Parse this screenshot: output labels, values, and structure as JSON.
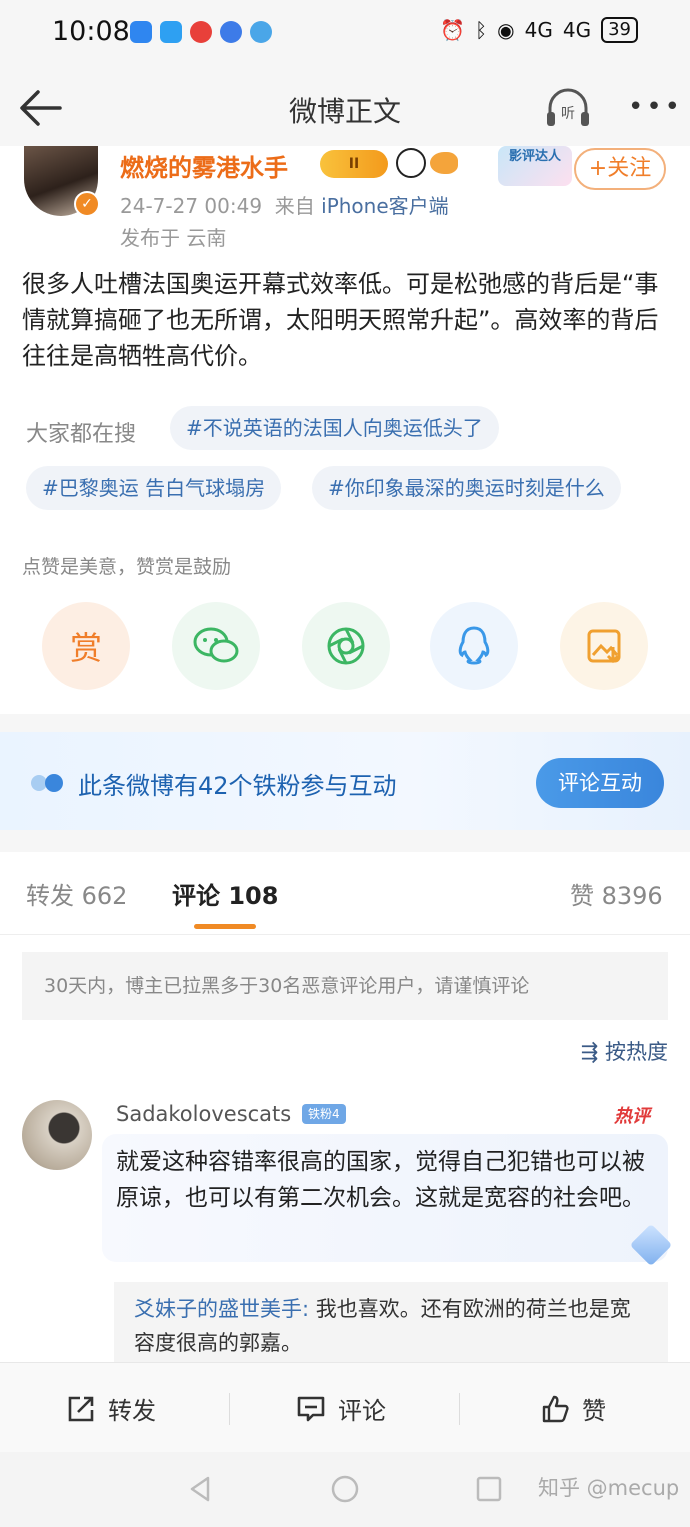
{
  "status_bar": {
    "time": "10:08",
    "battery": "39",
    "network": "4G"
  },
  "nav": {
    "title": "微博正文",
    "listen_label": "听",
    "more_label": "•••"
  },
  "post": {
    "author": "燃烧的雾港水手",
    "vip_level": "II",
    "award_label": "影评达人",
    "follow_label": "+关注",
    "time": "24-7-27 00:49",
    "source_prefix": "来自",
    "source": "iPhone客户端",
    "location": "发布于 云南",
    "body": "很多人吐槽法国奥运开幕式效率低。可是松弛感的背后是“事情就算搞砸了也无所谓，太阳明天照常升起”。高效率的背后往往是高牺牲高代价。",
    "search_label": "大家都在搜",
    "topics": [
      "#不说英语的法国人向奥运低头了",
      "#巴黎奥运 告白气球塌房",
      "#你印象最深的奥运时刻是什么"
    ],
    "reward_hint": "点赞是美意，赞赏是鼓励",
    "reward_label": "赏"
  },
  "fan_banner": {
    "text": "此条微博有42个铁粉参与互动",
    "button": "评论互动"
  },
  "tabs": {
    "repost": "转发 662",
    "comment_label": "评论",
    "comment_count": "108",
    "like": "赞 8396"
  },
  "comments": {
    "notice": "30天内，博主已拉黑多于30名恶意评论用户，请谨慎评论",
    "sort_label": "按热度",
    "items": [
      {
        "user": "Sadakolovescats",
        "fan_level": "铁粉4",
        "hot_tag": "热评",
        "text": "就爱这种容错率很高的国家，觉得自己犯错也可以被原谅，也可以有第二次机会。这就是宽容的社会吧。",
        "reply_user": "爻妹子的盛世美手:",
        "reply_text": " 我也喜欢。还有欧洲的荷兰也是宽容度很高的郭嘉。"
      }
    ]
  },
  "action_bar": {
    "repost": "转发",
    "comment": "评论",
    "like": "赞"
  },
  "watermark": "知乎 @mecup",
  "colors": {
    "accent_orange": "#f08a24",
    "link_blue": "#3a6fb0",
    "banner_blue": "#1d62b0"
  }
}
